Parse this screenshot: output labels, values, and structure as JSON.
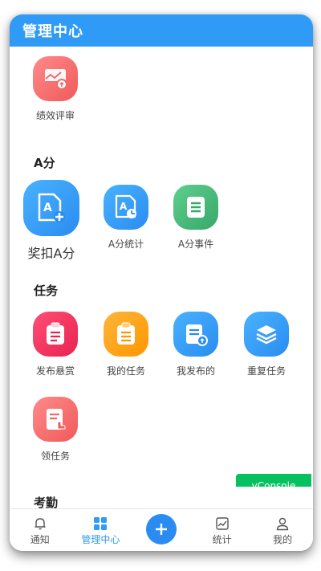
{
  "header": {
    "title": "管理中心"
  },
  "sections": {
    "top": {
      "items": [
        {
          "label": "绩效评审",
          "icon": "performance-chart-icon"
        }
      ]
    },
    "a_score": {
      "title": "A分",
      "items": [
        {
          "label": "奖扣A分",
          "icon": "a-score-add-icon"
        },
        {
          "label": "A分统计",
          "icon": "a-score-stats-icon"
        },
        {
          "label": "A分事件",
          "icon": "a-score-events-icon"
        }
      ]
    },
    "tasks": {
      "title": "任务",
      "items": [
        {
          "label": "发布悬赏",
          "icon": "bounty-clipboard-icon"
        },
        {
          "label": "我的任务",
          "icon": "my-tasks-icon"
        },
        {
          "label": "我发布的",
          "icon": "published-task-icon"
        },
        {
          "label": "重复任务",
          "icon": "layers-icon"
        },
        {
          "label": "领任务",
          "icon": "claim-task-icon"
        }
      ]
    },
    "attendance": {
      "title": "考勤"
    }
  },
  "vconsole": {
    "label": "vConsole"
  },
  "tabbar": {
    "items": [
      {
        "label": "通知",
        "icon": "bell-icon"
      },
      {
        "label": "管理中心",
        "icon": "grid-icon",
        "active": true
      },
      {
        "label": "",
        "icon": "plus-icon"
      },
      {
        "label": "统计",
        "icon": "chart-icon"
      },
      {
        "label": "我的",
        "icon": "user-icon"
      }
    ]
  },
  "colors": {
    "primary": "#2f9bf7",
    "vconsole": "#07c160"
  }
}
